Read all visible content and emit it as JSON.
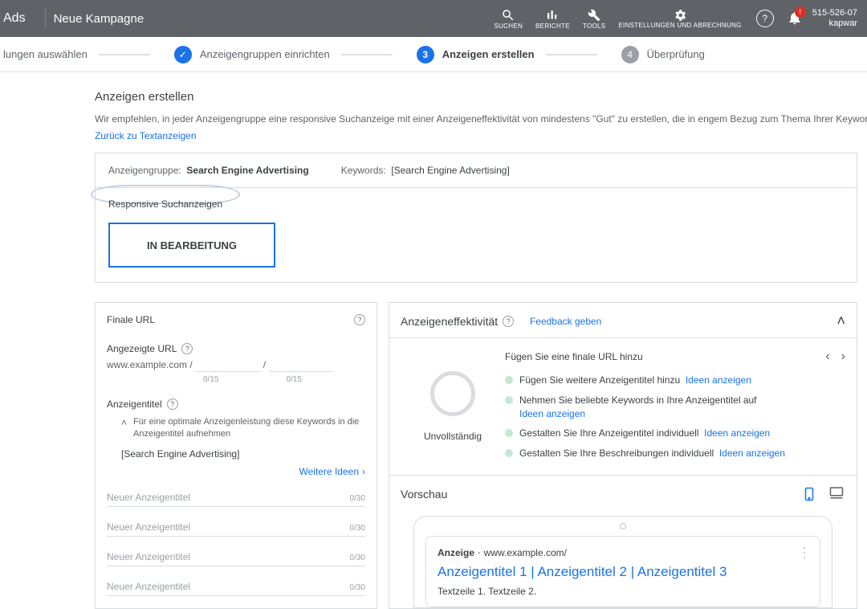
{
  "header": {
    "brand": "Ads",
    "title": "Neue Kampagne",
    "tools": {
      "search": "SUCHEN",
      "reports": "BERICHTE",
      "tools": "TOOLS",
      "settings": "EINSTELLUNGEN UND ABRECHNUNG"
    },
    "help": "?",
    "alert": "!",
    "account_id": "515-526-07",
    "account_name": "kapwar"
  },
  "steps": {
    "s1": "lungen auswählen",
    "s2": "Anzeigengruppen einrichten",
    "s3_num": "3",
    "s3": "Anzeigen erstellen",
    "s4_num": "4",
    "s4": "Überprüfung"
  },
  "intro": {
    "title": "Anzeigen erstellen",
    "help": "Wir empfehlen, in jeder Anzeigengruppe eine responsive Suchanzeige mit einer Anzeigeneffektivität von mindestens \"Gut\" zu erstellen, die in engem Bezug zum Thema Ihrer Keywords steht.",
    "back_link": "Zurück zu Textanzeigen"
  },
  "adgroup": {
    "label": "Anzeigengruppe:",
    "value": "Search Engine Advertising",
    "kw_label": "Keywords:",
    "kw_value": "[Search Engine Advertising]",
    "type": "Responsive Suchanzeigen",
    "status": "IN BEARBEITUNG"
  },
  "left": {
    "final_url": "Finale URL",
    "display_url": "Angezeigte URL",
    "base_url": "www.example.com /",
    "sep": "/",
    "c1": "0/15",
    "c2": "0/15",
    "headlines": "Anzeigentitel",
    "tip": "Für eine optimale Anzeigenleistung diese Keywords in die Anzeigentitel aufnehmen",
    "kw": "[Search Engine Advertising]",
    "more": "Weitere Ideen",
    "hl_ph": "Neuer Anzeigentitel",
    "hl_ct": "0/30"
  },
  "eff": {
    "title": "Anzeigeneffektivität",
    "feedback": "Feedback geben",
    "state": "Unvollständig",
    "msg": "Fügen Sie eine finale URL hinzu",
    "s1": "Fügen Sie weitere Anzeigentitel hinzu",
    "s1l": "Ideen anzeigen",
    "s2": "Nehmen Sie beliebte Keywords in Ihre Anzeigentitel auf",
    "s2l": "Ideen anzeigen",
    "s3": "Gestalten Sie Ihre Anzeigentitel individuell",
    "s3l": "Ideen anzeigen",
    "s4": "Gestalten Sie Ihre Beschreibungen individuell",
    "s4l": "Ideen anzeigen"
  },
  "preview": {
    "title": "Vorschau",
    "tag": "Anzeige",
    "dot": "·",
    "url": "www.example.com/",
    "headline": "Anzeigentitel 1 | Anzeigentitel 2 | Anzeigentitel 3",
    "desc": "Textzeile 1. Textzeile 2."
  }
}
